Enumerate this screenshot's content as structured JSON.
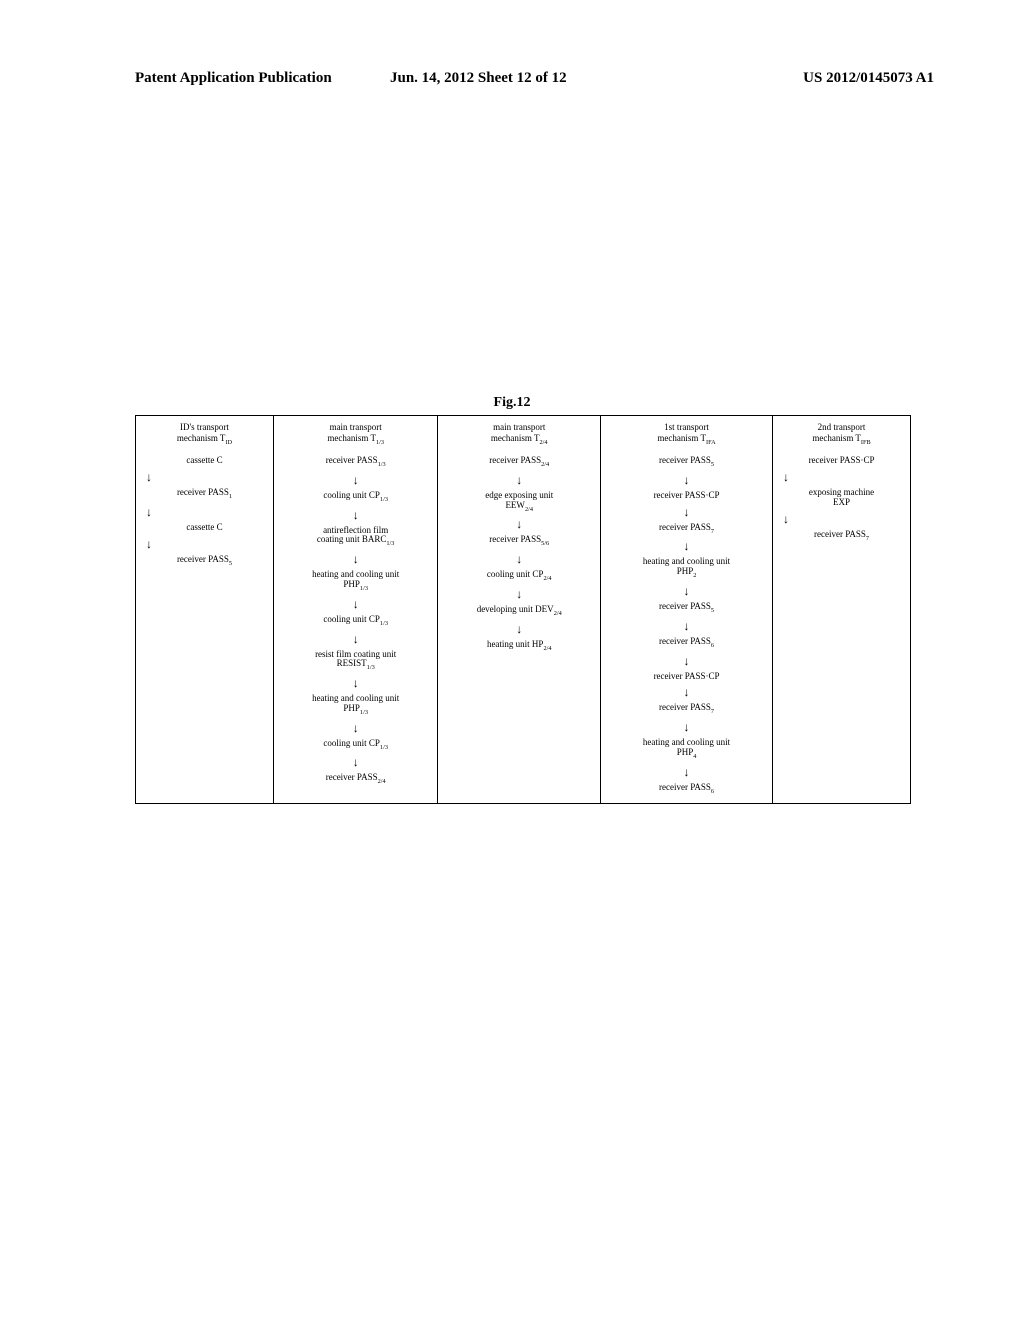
{
  "header": {
    "left": "Patent Application Publication",
    "center": "Jun. 14, 2012  Sheet 12 of 12",
    "right": "US 2012/0145073 A1"
  },
  "figure_label": "Fig.12",
  "table": {
    "columns": [
      {
        "title_line1": "ID's transport",
        "title_line2": "mechanism T",
        "title_sub": "ID",
        "steps": [
          {
            "text": "cassette C"
          },
          {
            "type": "arrow-left"
          },
          {
            "text": "receiver PASS",
            "sub": "1"
          },
          {
            "type": "arrow-left"
          },
          {
            "text": "cassette C"
          },
          {
            "type": "arrow-left"
          },
          {
            "text": "receiver PASS",
            "sub": "5"
          }
        ]
      },
      {
        "title_line1": "main transport",
        "title_line2": "mechanism T",
        "title_sub": "1/3",
        "steps": [
          {
            "text": "receiver PASS",
            "sub": "1/3"
          },
          {
            "type": "arrow"
          },
          {
            "text": "cooling unit CP",
            "sub": "1/3"
          },
          {
            "type": "arrow"
          },
          {
            "text_line1": "antireflection film",
            "text_line2": "coating unit BARC",
            "sub": "1/3"
          },
          {
            "type": "arrow"
          },
          {
            "text_line1": "heating and cooling unit",
            "text_line2": "PHP",
            "sub": "1/3"
          },
          {
            "type": "arrow"
          },
          {
            "text": "cooling unit CP",
            "sub": "1/3"
          },
          {
            "type": "arrow"
          },
          {
            "text_line1": "resist film coating unit",
            "text_line2": "RESIST",
            "sub": "1/3"
          },
          {
            "type": "arrow"
          },
          {
            "text_line1": "heating and cooling unit",
            "text_line2": "PHP",
            "sub": "1/3"
          },
          {
            "type": "arrow"
          },
          {
            "text": "cooling unit CP",
            "sub": "1/3"
          },
          {
            "type": "arrow"
          },
          {
            "text": "receiver PASS",
            "sub": "2/4"
          }
        ]
      },
      {
        "title_line1": "main transport",
        "title_line2": "mechanism T",
        "title_sub": "2/4",
        "steps": [
          {
            "text": "receiver PASS",
            "sub": "2/4"
          },
          {
            "type": "arrow"
          },
          {
            "text_line1": "edge exposing unit",
            "text_line2": "EEW",
            "sub": "2/4"
          },
          {
            "type": "arrow"
          },
          {
            "text": "receiver PASS",
            "sub": "5/6"
          },
          {
            "type": "arrow"
          },
          {
            "text": "cooling unit CP",
            "sub": "2/4"
          },
          {
            "type": "arrow"
          },
          {
            "text": "developing unit DEV",
            "sub": "2/4"
          },
          {
            "type": "arrow"
          },
          {
            "text": "heating unit HP",
            "sub": "2/4"
          }
        ]
      },
      {
        "title_line1": "1st transport",
        "title_line2": "mechanism T",
        "title_sub": "IFA",
        "steps": [
          {
            "text": "receiver PASS",
            "sub": "5"
          },
          {
            "type": "arrow"
          },
          {
            "text": "receiver PASS·CP"
          },
          {
            "type": "arrow"
          },
          {
            "text": "receiver PASS",
            "sub": "7"
          },
          {
            "type": "arrow"
          },
          {
            "text_line1": "heating and cooling unit",
            "text_line2": "PHP",
            "sub": "2"
          },
          {
            "type": "arrow"
          },
          {
            "text": "receiver PASS",
            "sub": "5"
          },
          {
            "type": "arrow"
          },
          {
            "text": "receiver PASS",
            "sub": "6"
          },
          {
            "type": "arrow"
          },
          {
            "text": "receiver PASS·CP"
          },
          {
            "type": "arrow"
          },
          {
            "text": "receiver PASS",
            "sub": "7"
          },
          {
            "type": "arrow"
          },
          {
            "text_line1": "heating and cooling unit",
            "text_line2": "PHP",
            "sub": "4"
          },
          {
            "type": "arrow"
          },
          {
            "text": "receiver PASS",
            "sub": "6"
          }
        ]
      },
      {
        "title_line1": "2nd transport",
        "title_line2": "mechanism T",
        "title_sub": "IFB",
        "steps": [
          {
            "text": "receiver PASS·CP"
          },
          {
            "type": "arrow-left"
          },
          {
            "text_line1": "exposing machine",
            "text_line2": "EXP"
          },
          {
            "type": "arrow-left"
          },
          {
            "text": "receiver PASS",
            "sub": "7"
          }
        ]
      }
    ]
  }
}
